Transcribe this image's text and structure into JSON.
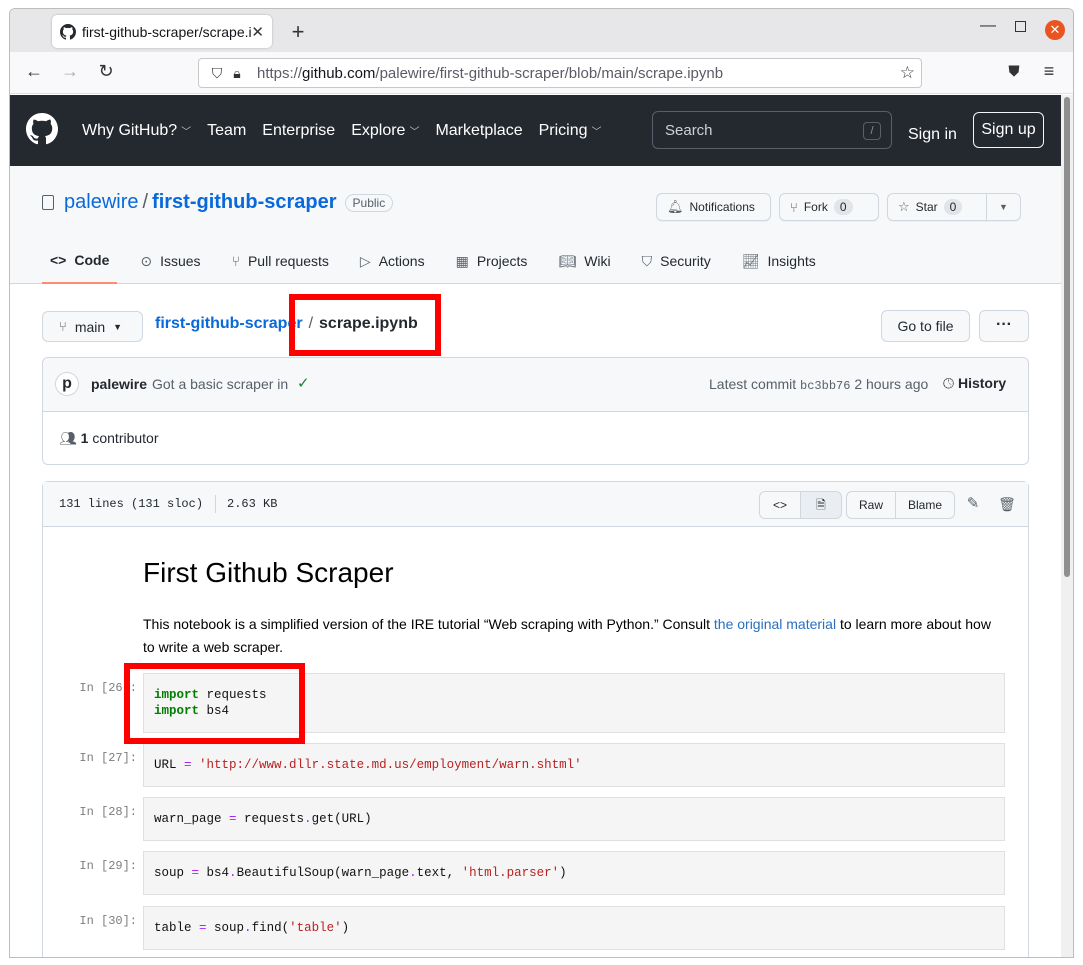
{
  "browser": {
    "tab_title": "first-github-scraper/scrape.ipynb",
    "url_scheme": "https://",
    "url_host": "github.com",
    "url_path": "/palewire/first-github-scraper/blob/main/scrape.ipynb"
  },
  "github_header": {
    "nav": [
      "Why GitHub?",
      "Team",
      "Enterprise",
      "Explore",
      "Marketplace",
      "Pricing"
    ],
    "search_placeholder": "Search",
    "search_key": "/",
    "sign_in": "Sign in",
    "sign_up": "Sign up"
  },
  "repo": {
    "owner": "palewire",
    "name": "first-github-scraper",
    "visibility": "Public",
    "notifications": "Notifications",
    "fork_label": "Fork",
    "fork_count": "0",
    "star_label": "Star",
    "star_count": "0",
    "tabs": [
      "Code",
      "Issues",
      "Pull requests",
      "Actions",
      "Projects",
      "Wiki",
      "Security",
      "Insights"
    ]
  },
  "file": {
    "branch": "main",
    "repo_link": "first-github-scraper",
    "filename": "scrape.ipynb",
    "go_to_file": "Go to file",
    "more": "···",
    "commit_author": "palewire",
    "commit_message": "Got a basic scraper in",
    "latest_commit_label": "Latest commit",
    "commit_sha": "bc3bb76",
    "commit_time": "2 hours ago",
    "history": "History",
    "contributors_count": "1",
    "contributors_label": "contributor",
    "lines": "131 lines (131 sloc)",
    "size": "2.63 KB",
    "raw": "Raw",
    "blame": "Blame"
  },
  "notebook": {
    "title": "First Github Scraper",
    "para_before": "This notebook is a simplified version of the IRE tutorial “Web scraping with Python.” Consult ",
    "para_link": "the original material",
    "para_after": " to learn more about how to write a web scraper.",
    "cells": [
      {
        "prompt": "In [26]:"
      },
      {
        "prompt": "In [27]:"
      },
      {
        "prompt": "In [28]:"
      },
      {
        "prompt": "In [29]:"
      },
      {
        "prompt": "In [30]:"
      }
    ]
  },
  "colors": {
    "gh_header_bg": "#24292f",
    "link": "#0969da",
    "highlight": "#ff0000",
    "active_tab_underline": "#fd8c73"
  }
}
